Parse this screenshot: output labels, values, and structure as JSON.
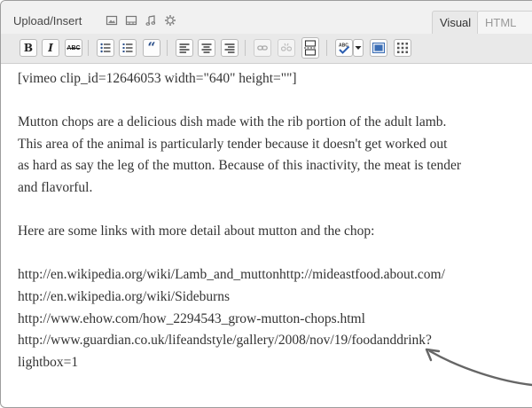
{
  "upload_bar": {
    "label": "Upload/Insert",
    "icons": [
      "image-icon",
      "video-icon",
      "audio-icon",
      "media-gear-icon"
    ]
  },
  "tabs": {
    "visual": "Visual",
    "html": "HTML",
    "active": "visual"
  },
  "toolbar": {
    "buttons": [
      "bold",
      "italic",
      "strikethrough",
      "bulleted-list",
      "numbered-list",
      "blockquote",
      "align-left",
      "align-center",
      "align-right",
      "insert-link",
      "unlink",
      "insert-more",
      "spellcheck",
      "spellcheck-dropdown",
      "fullscreen",
      "kitchen-sink"
    ],
    "bold_label": "B",
    "italic_label": "I",
    "strike_label": "ABC",
    "quote_label": "“"
  },
  "content": {
    "shortcode": "[vimeo clip_id=12646053 width=\"640\" height=\"\"]",
    "para1": [
      "Mutton chops are a delicious dish made with the rib portion of the adult lamb.",
      "This area of the animal is particularly tender because it doesn't get worked out",
      "as hard as say the leg of the mutton. Because of this inactivity, the meat is tender",
      "and flavorful."
    ],
    "para2": "Here are some links with more detail about mutton and the chop:",
    "links": [
      "http://en.wikipedia.org/wiki/Lamb_and_muttonhttp://mideastfood.about.com/",
      "http://en.wikipedia.org/wiki/Sideburns",
      "http://www.ehow.com/how_2294543_grow-mutton-chops.html",
      "http://www.guardian.co.uk/lifeandstyle/gallery/2008/nov/19/foodanddrink?",
      "lightbox=1"
    ]
  }
}
